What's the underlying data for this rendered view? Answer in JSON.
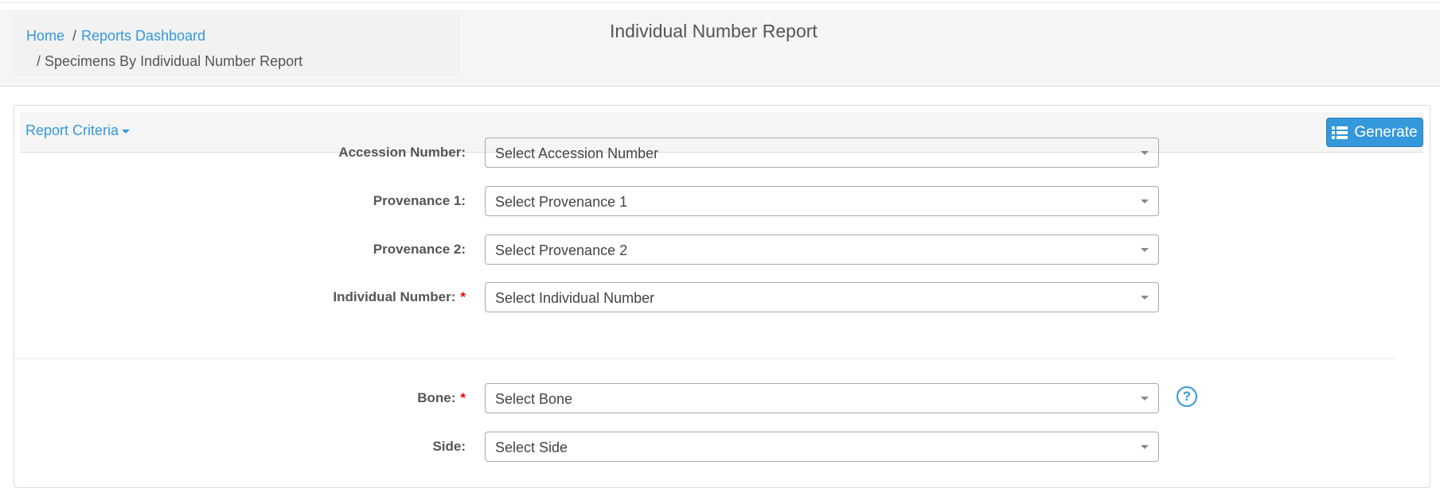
{
  "breadcrumb": {
    "home": "Home",
    "separator": "/",
    "dashboard": "Reports Dashboard",
    "current": "Specimens By Individual Number Report"
  },
  "page_title": "Individual Number Report",
  "panel": {
    "criteria_label": "Report Criteria",
    "generate_label": "Generate",
    "generate_icon": "list-icon",
    "accent": "#3498db"
  },
  "fields": [
    {
      "label": "Accession Number:",
      "placeholder": "Select Accession Number",
      "required": false
    },
    {
      "label": "Provenance 1:",
      "placeholder": "Select Provenance 1",
      "required": false
    },
    {
      "label": "Provenance 2:",
      "placeholder": "Select Provenance 2",
      "required": false
    },
    {
      "label": "Individual Number:",
      "placeholder": "Select Individual Number",
      "required": true
    },
    {
      "label": "Bone:",
      "placeholder": "Select Bone",
      "required": true
    },
    {
      "label": "Side:",
      "placeholder": "Select Side",
      "required": false
    }
  ],
  "required_marker": "*",
  "help_icon": "question-circle-icon",
  "help_glyph": "?"
}
